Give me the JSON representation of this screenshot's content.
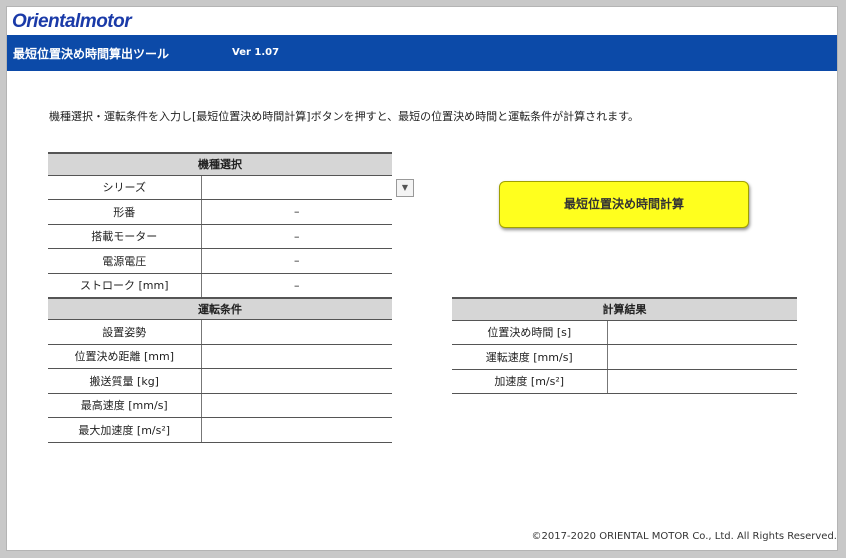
{
  "header": {
    "logo": "Orientalmotor",
    "app_title": "最短位置決め時間算出ツール",
    "version": "Ver 1.07"
  },
  "instruction": "機種選択・運転条件を入力し[最短位置決め時間計算]ボタンを押すと、最短の位置決め時間と運転条件が計算されます。",
  "model_selection": {
    "header": "機種選択",
    "rows": [
      {
        "label": "シリーズ",
        "value": ""
      },
      {
        "label": "形番",
        "value": "–"
      },
      {
        "label": "搭載モーター",
        "value": "–"
      },
      {
        "label": "電源電圧",
        "value": "–"
      },
      {
        "label": "ストローク [mm]",
        "value": "–"
      }
    ]
  },
  "operating_conditions": {
    "header": "運転条件",
    "rows": [
      {
        "label": "設置姿勢",
        "value": ""
      },
      {
        "label": "位置決め距離 [mm]",
        "value": ""
      },
      {
        "label": "搬送質量 [kg]",
        "value": ""
      },
      {
        "label": "最高速度 [mm/s]",
        "value": ""
      },
      {
        "label": "最大加速度 [m/s²]",
        "value": ""
      }
    ]
  },
  "calc_button": "最短位置決め時間計算",
  "results": {
    "header": "計算結果",
    "rows": [
      {
        "label": "位置決め時間 [s]",
        "value": ""
      },
      {
        "label": "運転速度 [mm/s]",
        "value": ""
      },
      {
        "label": "加速度 [m/s²]",
        "value": ""
      }
    ]
  },
  "copyright": "©2017-2020 ORIENTAL MOTOR Co., Ltd. All Rights Reserved.",
  "colors": {
    "titlebar": "#0c4aa8",
    "logo": "#1a3aa8",
    "calc_button": "#ffff1e",
    "table_header": "#d6d6d6"
  }
}
